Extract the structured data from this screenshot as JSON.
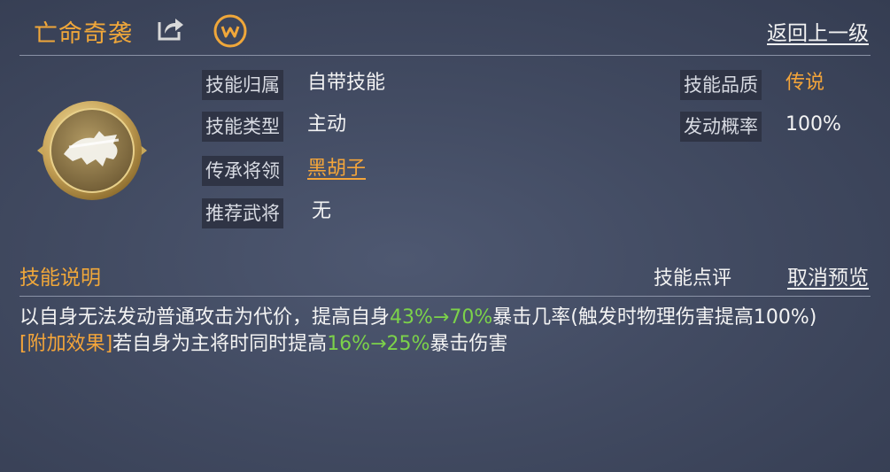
{
  "header": {
    "title": "亡命奇袭",
    "back_label": "返回上一级",
    "icons": [
      "share-icon",
      "wechat-icon"
    ]
  },
  "skill": {
    "icon": "galloping-horse-icon",
    "fields_left": [
      {
        "label": "技能归属",
        "value": "自带技能"
      },
      {
        "label": "技能类型",
        "value": "主动"
      },
      {
        "label": "传承将领",
        "value": "黑胡子"
      },
      {
        "label": "推荐武将",
        "value": "无"
      }
    ],
    "fields_right": [
      {
        "label": "技能品质",
        "value": "传说"
      },
      {
        "label": "发动概率",
        "value": "100%"
      }
    ]
  },
  "description": {
    "title": "技能说明",
    "rate_label": "技能点评",
    "cancel_label": "取消预览",
    "line1_a": "以自身无法发动普通攻击为代价，提高自身",
    "line1_hl": "43%→70%",
    "line1_b": "暴击几率(触发时物理伤害提高100%)",
    "line2_tag": "[附加效果]",
    "line2_a": "若自身为主将时同时提高",
    "line2_hl": "16%→25%",
    "line2_b": "暴击伤害"
  },
  "colors": {
    "accent_orange": "#f0a73a",
    "highlight_green": "#7cd24a",
    "background": "#424b62"
  }
}
